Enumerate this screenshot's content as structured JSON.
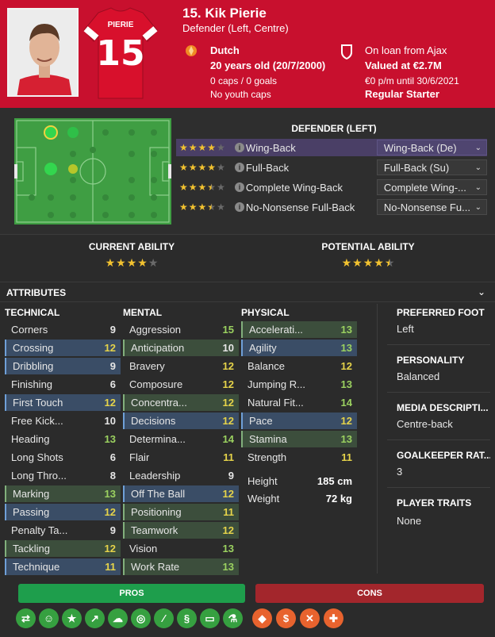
{
  "header": {
    "shirt_name": "PIERIE",
    "shirt_number": "15",
    "name": "15. Kik Pierie",
    "position": "Defender (Left, Centre)",
    "nationality": "Dutch",
    "age": "20 years old (20/7/2000)",
    "caps": "0 caps / 0 goals",
    "youth_caps": "No youth caps",
    "loan": "On loan from Ajax",
    "value": "Valued at €2.7M",
    "wage": "€0 p/m until 30/6/2021",
    "status": "Regular Starter",
    "colors": {
      "club_red": "#c8102e"
    }
  },
  "roles": {
    "title": "DEFENDER (LEFT)",
    "items": [
      {
        "name": "Wing-Back",
        "duty": "Wing-Back (De)",
        "stars": [
          1,
          1,
          1,
          1,
          0
        ]
      },
      {
        "name": "Full-Back",
        "duty": "Full-Back (Su)",
        "stars": [
          1,
          1,
          1,
          1,
          0
        ]
      },
      {
        "name": "Complete Wing-Back",
        "duty": "Complete Wing-...",
        "stars": [
          1,
          1,
          1,
          0.5,
          0
        ]
      },
      {
        "name": "No-Nonsense Full-Back",
        "duty": "No-Nonsense Fu...",
        "stars": [
          1,
          1,
          1,
          0.5,
          0
        ]
      }
    ]
  },
  "ability": {
    "current_label": "CURRENT ABILITY",
    "potential_label": "POTENTIAL ABILITY",
    "current_stars": 4,
    "potential_stars": 4.5
  },
  "attributes": {
    "title": "ATTRIBUTES",
    "technical_title": "TECHNICAL",
    "mental_title": "MENTAL",
    "physical_title": "PHYSICAL",
    "technical": [
      {
        "name": "Corners",
        "value": "9",
        "hl": ""
      },
      {
        "name": "Crossing",
        "value": "12",
        "hl": "hl"
      },
      {
        "name": "Dribbling",
        "value": "9",
        "hl": "hl"
      },
      {
        "name": "Finishing",
        "value": "6",
        "hl": ""
      },
      {
        "name": "First Touch",
        "value": "12",
        "hl": "hl"
      },
      {
        "name": "Free Kick...",
        "value": "10",
        "hl": ""
      },
      {
        "name": "Heading",
        "value": "13",
        "hl": ""
      },
      {
        "name": "Long Shots",
        "value": "6",
        "hl": ""
      },
      {
        "name": "Long Thro...",
        "value": "8",
        "hl": ""
      },
      {
        "name": "Marking",
        "value": "13",
        "hl": "hg"
      },
      {
        "name": "Passing",
        "value": "12",
        "hl": "hl"
      },
      {
        "name": "Penalty Ta...",
        "value": "9",
        "hl": ""
      },
      {
        "name": "Tackling",
        "value": "12",
        "hl": "hg"
      },
      {
        "name": "Technique",
        "value": "11",
        "hl": "hl"
      }
    ],
    "mental": [
      {
        "name": "Aggression",
        "value": "15",
        "hl": ""
      },
      {
        "name": "Anticipation",
        "value": "10",
        "hl": "hg"
      },
      {
        "name": "Bravery",
        "value": "12",
        "hl": ""
      },
      {
        "name": "Composure",
        "value": "12",
        "hl": ""
      },
      {
        "name": "Concentra...",
        "value": "12",
        "hl": "hg"
      },
      {
        "name": "Decisions",
        "value": "12",
        "hl": "hl"
      },
      {
        "name": "Determina...",
        "value": "14",
        "hl": ""
      },
      {
        "name": "Flair",
        "value": "11",
        "hl": ""
      },
      {
        "name": "Leadership",
        "value": "9",
        "hl": ""
      },
      {
        "name": "Off The Ball",
        "value": "12",
        "hl": "hl"
      },
      {
        "name": "Positioning",
        "value": "11",
        "hl": "hg"
      },
      {
        "name": "Teamwork",
        "value": "12",
        "hl": "hg"
      },
      {
        "name": "Vision",
        "value": "13",
        "hl": ""
      },
      {
        "name": "Work Rate",
        "value": "13",
        "hl": "hg"
      }
    ],
    "physical": [
      {
        "name": "Accelerati...",
        "value": "13",
        "hl": "hg"
      },
      {
        "name": "Agility",
        "value": "13",
        "hl": "hl"
      },
      {
        "name": "Balance",
        "value": "12",
        "hl": ""
      },
      {
        "name": "Jumping R...",
        "value": "13",
        "hl": ""
      },
      {
        "name": "Natural Fit...",
        "value": "14",
        "hl": ""
      },
      {
        "name": "Pace",
        "value": "12",
        "hl": "hl"
      },
      {
        "name": "Stamina",
        "value": "13",
        "hl": "hg"
      },
      {
        "name": "Strength",
        "value": "11",
        "hl": ""
      }
    ],
    "height_label": "Height",
    "height": "185 cm",
    "weight_label": "Weight",
    "weight": "72 kg"
  },
  "side": {
    "foot_label": "PREFERRED FOOT",
    "foot": "Left",
    "personality_label": "PERSONALITY",
    "personality": "Balanced",
    "media_label": "MEDIA DESCRIPTI...",
    "media": "Centre-back",
    "gk_label": "GOALKEEPER RAT...",
    "gk": "3",
    "traits_label": "PLAYER TRAITS",
    "traits": "None"
  },
  "pros_label": "PROS",
  "cons_label": "CONS",
  "pros_icons": [
    "arrows-icon",
    "smile-icon",
    "star-icon",
    "trend-icon",
    "brain-icon",
    "target-icon",
    "bandage-icon",
    "dna-icon",
    "pitch-icon",
    "flask-icon"
  ],
  "cons_icons": [
    "tag-icon",
    "money-bag-icon",
    "boot-icon",
    "medical-cross-icon"
  ]
}
